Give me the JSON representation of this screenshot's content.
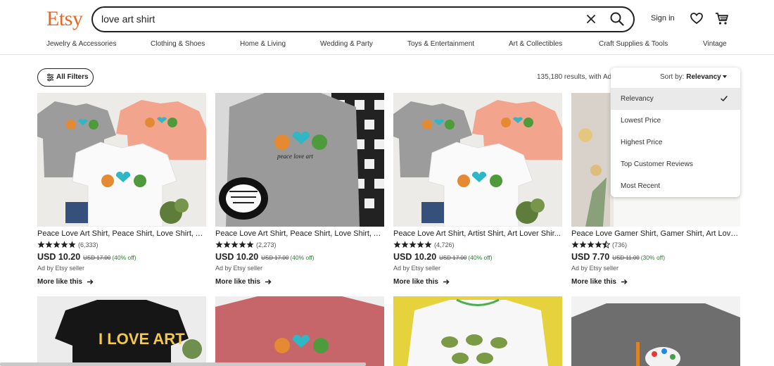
{
  "header": {
    "logo": "Etsy",
    "search_value": "love art shirt",
    "sign_in": "Sign in",
    "brand_color": "#f1641e"
  },
  "categories": [
    "Jewelry & Accessories",
    "Clothing & Shoes",
    "Home & Living",
    "Wedding & Party",
    "Toys & Entertainment",
    "Art & Collectibles",
    "Craft Supplies & Tools",
    "Vintage"
  ],
  "toolbar": {
    "filters_label": "All Filters",
    "results_text": "135,180 results, with Ad"
  },
  "sort": {
    "label": "Sort by:",
    "selected": "Relevancy",
    "options": [
      "Relevancy",
      "Lowest Price",
      "Highest Price",
      "Top Customer Reviews",
      "Most Recent"
    ]
  },
  "products": [
    {
      "title": "Peace Love Art Shirt, Peace Shirt, Love Shirt, A...",
      "rating": 5,
      "reviews": "(6,333)",
      "price": "USD 10.20",
      "original": "USD 17.00",
      "discount": "(40% off)",
      "ad": "Ad by Etsy seller",
      "more": "More like this",
      "image": "three-peace-love-art-shirts"
    },
    {
      "title": "Peace Love Art Shirt, Peace Shirt, Love Shirt, A...",
      "rating": 5,
      "reviews": "(2,273)",
      "price": "USD 10.20",
      "original": "USD 17.00",
      "discount": "(40% off)",
      "ad": "Ad by Etsy seller",
      "more": "More like this",
      "image": "grey-shirt-with-sneakers-and-plaid"
    },
    {
      "title": "Peace Love Art Shirt, Artist Shirt, Art Lover Shir...",
      "rating": 5,
      "reviews": "(4,726)",
      "price": "USD 10.20",
      "original": "USD 17.00",
      "discount": "(40% off)",
      "ad": "Ad by Etsy seller",
      "more": "More like this",
      "image": "three-peace-love-art-shirts"
    },
    {
      "title": "Peace Love Gamer Shirt, Gamer Shirt, Art Love...",
      "rating": 4.5,
      "reviews": "(736)",
      "price": "USD 7.70",
      "original": "USD 11.00",
      "discount": "(30% off)",
      "ad": "Ad by Etsy seller",
      "more": "More like this",
      "image": "white-shirt-lifestyle"
    }
  ],
  "second_row": [
    {
      "image": "black-i-love-art-shirt",
      "text": "I LOVE ART"
    },
    {
      "image": "rose-peace-love-art-shirt"
    },
    {
      "image": "white-frog-shirt-on-yellow"
    },
    {
      "image": "grey-paint-palette-shirt"
    }
  ]
}
